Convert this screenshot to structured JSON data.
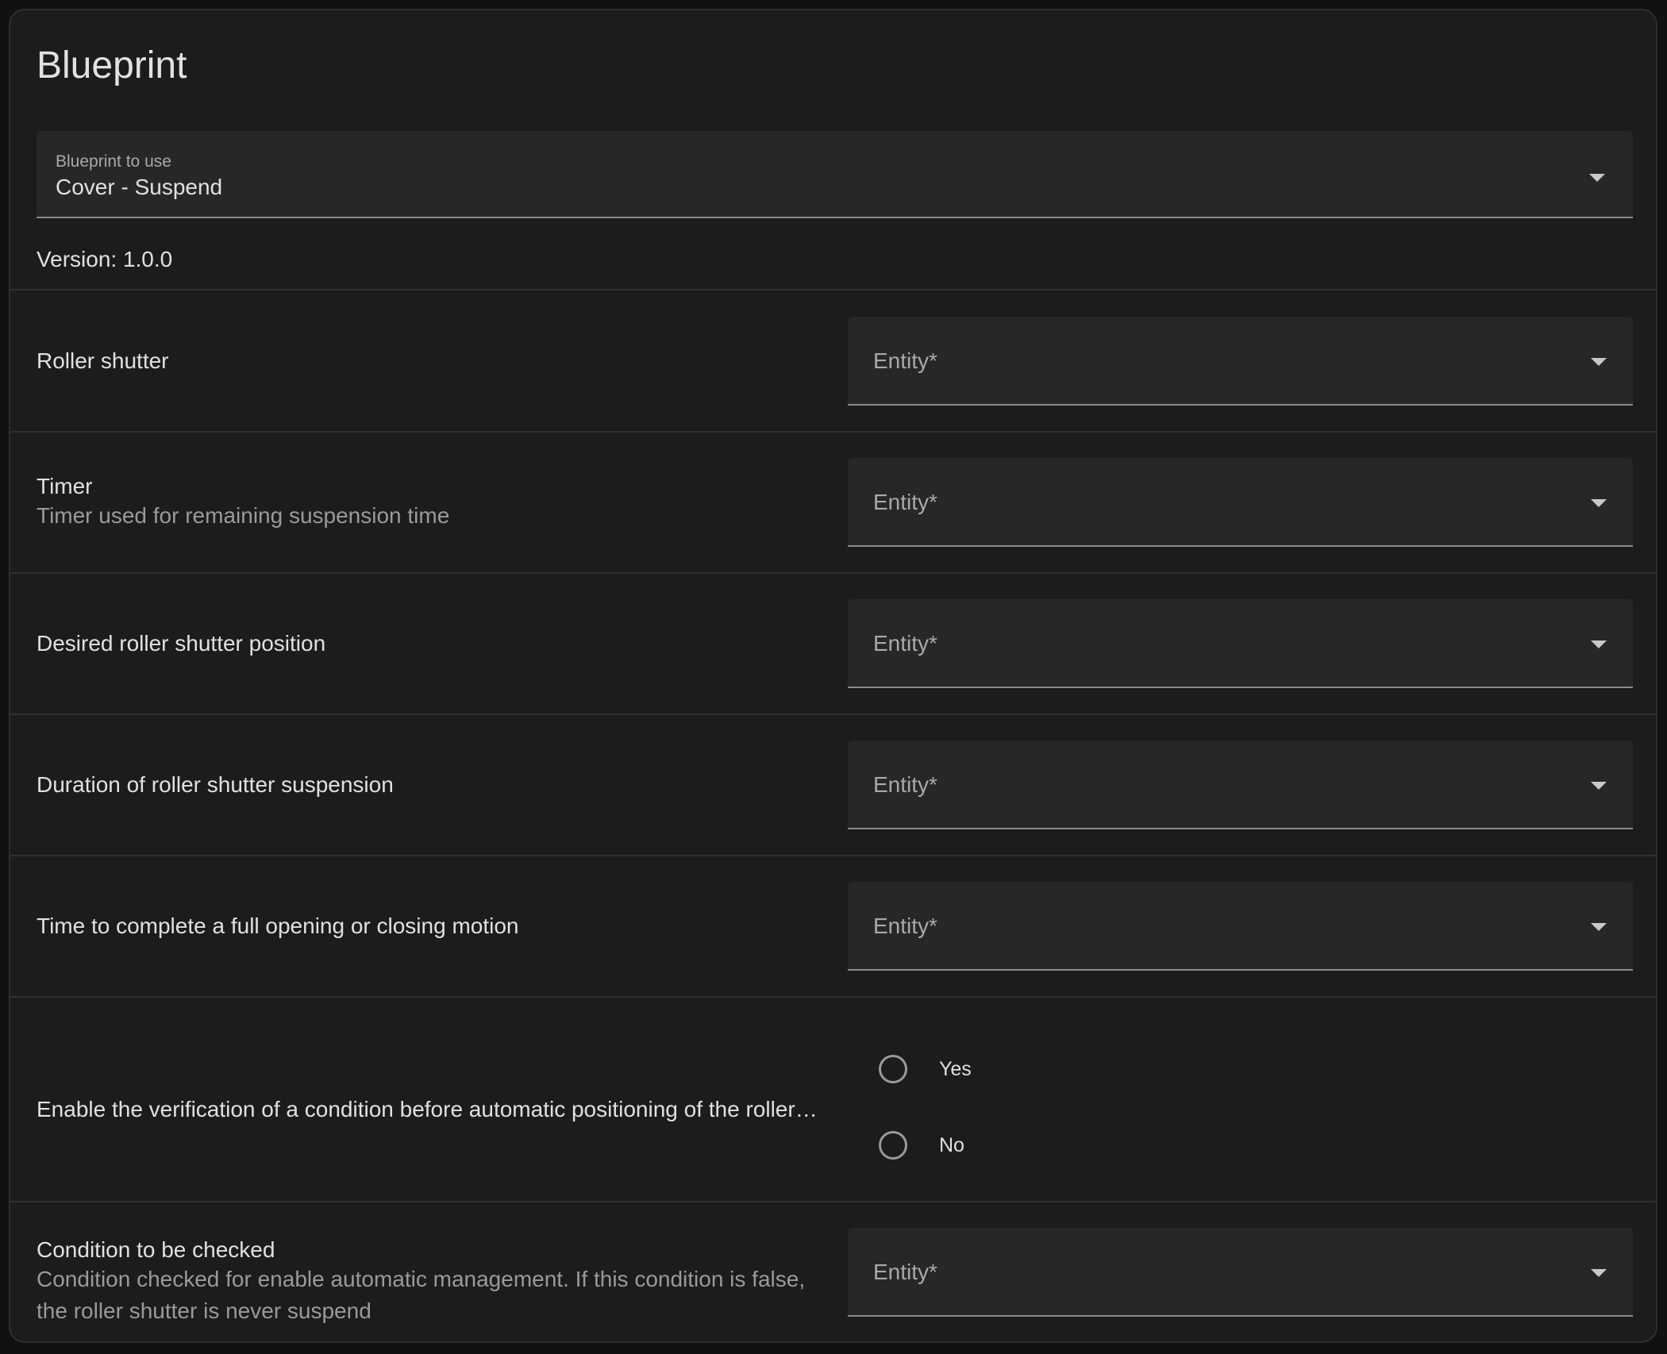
{
  "title": "Blueprint",
  "blueprint_select": {
    "label": "Blueprint to use",
    "value": "Cover - Suspend"
  },
  "version": "Version: 1.0.0",
  "rows": [
    {
      "label": "Roller shutter",
      "description": "",
      "placeholder": "Entity*"
    },
    {
      "label": "Timer",
      "description": "Timer used for remaining suspension time",
      "placeholder": "Entity*"
    },
    {
      "label": "Desired roller shutter position",
      "description": "",
      "placeholder": "Entity*"
    },
    {
      "label": "Duration of roller shutter suspension",
      "description": "",
      "placeholder": "Entity*"
    },
    {
      "label": "Time to complete a full opening or closing motion",
      "description": "",
      "placeholder": "Entity*"
    }
  ],
  "condition_toggle": {
    "label": "Enable the verification of a condition before automatic positioning of the roller…",
    "options": [
      "Yes",
      "No"
    ],
    "selected": null
  },
  "condition_row": {
    "label": "Condition to be checked",
    "description": "Condition checked for enable automatic management. If this condition is false, the roller shutter is never suspend",
    "placeholder": "Entity*"
  }
}
